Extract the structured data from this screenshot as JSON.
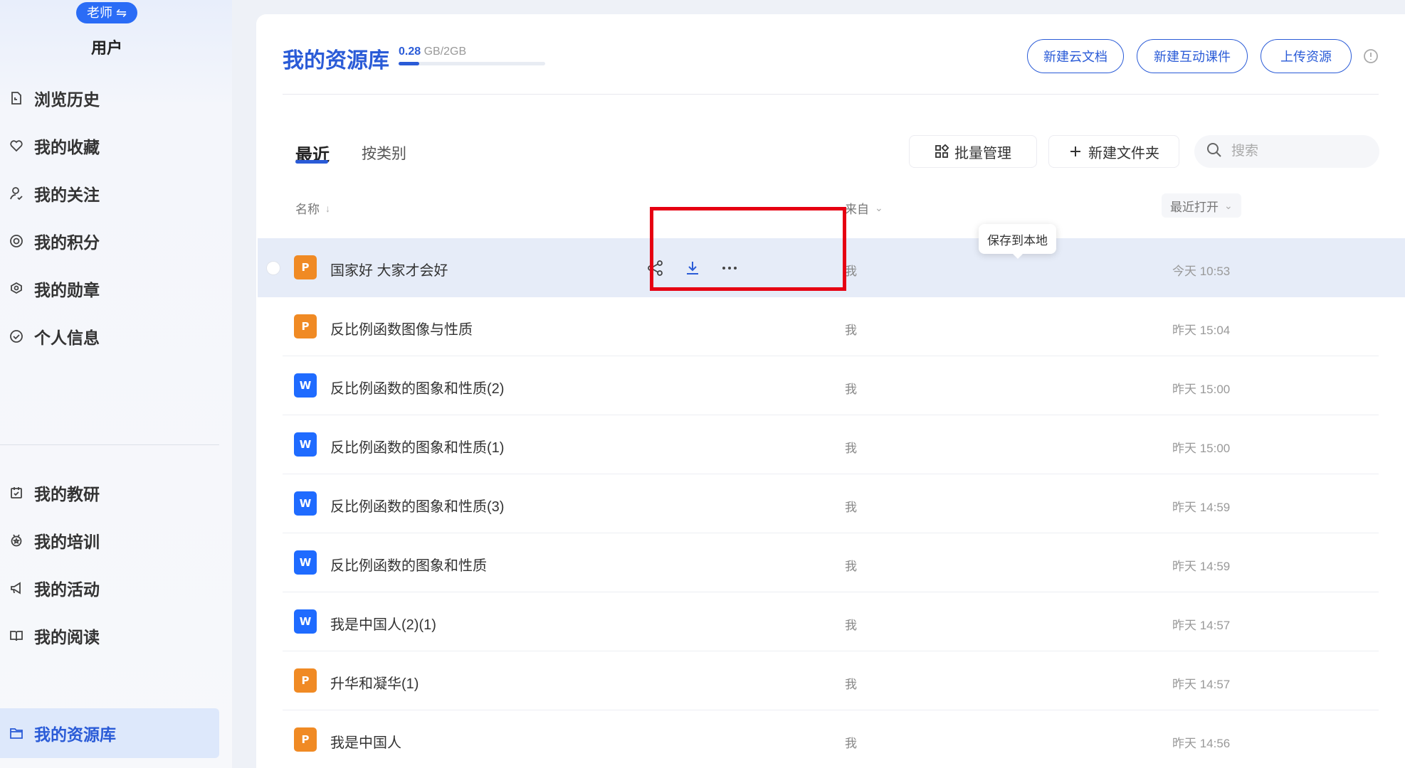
{
  "sidebar": {
    "role_badge": "老师 ⇋",
    "user_name": "用户",
    "items": [
      {
        "label": "浏览历史",
        "icon": "history-icon"
      },
      {
        "label": "我的收藏",
        "icon": "heart-icon"
      },
      {
        "label": "我的关注",
        "icon": "follow-icon"
      },
      {
        "label": "我的积分",
        "icon": "points-icon"
      },
      {
        "label": "我的勋章",
        "icon": "medal-icon"
      },
      {
        "label": "个人信息",
        "icon": "check-circle-icon"
      },
      {
        "label": "我的教研",
        "icon": "research-icon"
      },
      {
        "label": "我的培训",
        "icon": "training-icon"
      },
      {
        "label": "我的活动",
        "icon": "megaphone-icon"
      },
      {
        "label": "我的阅读",
        "icon": "book-icon"
      },
      {
        "label": "我的资源库",
        "icon": "folder-icon",
        "active": true
      }
    ]
  },
  "header": {
    "title": "我的资源库",
    "storage_used": "0.28",
    "storage_total": "GB/2GB",
    "storage_fraction": 0.14,
    "buttons": {
      "new_cloud_doc": "新建云文档",
      "new_interactive": "新建互动课件",
      "upload": "上传资源"
    }
  },
  "tabs": {
    "recent": "最近",
    "by_category": "按类别"
  },
  "toolbar": {
    "batch_manage": "批量管理",
    "new_folder": "新建文件夹",
    "search_placeholder": "搜索"
  },
  "columns": {
    "name": "名称",
    "source": "来自",
    "last_opened": "最近打开"
  },
  "tooltip": "保存到本地",
  "files": [
    {
      "name": "国家好 大家才会好",
      "type": "ppt",
      "source": "我",
      "time": "今天 10:53"
    },
    {
      "name": "反比例函数图像与性质",
      "type": "ppt",
      "source": "我",
      "time": "昨天 15:04"
    },
    {
      "name": "反比例函数的图象和性质(2)",
      "type": "word",
      "source": "我",
      "time": "昨天 15:00"
    },
    {
      "name": "反比例函数的图象和性质(1)",
      "type": "word",
      "source": "我",
      "time": "昨天 15:00"
    },
    {
      "name": "反比例函数的图象和性质(3)",
      "type": "word",
      "source": "我",
      "time": "昨天 14:59"
    },
    {
      "name": "反比例函数的图象和性质",
      "type": "word",
      "source": "我",
      "time": "昨天 14:59"
    },
    {
      "name": "我是中国人(2)(1)",
      "type": "word",
      "source": "我",
      "time": "昨天 14:57"
    },
    {
      "name": "升华和凝华(1)",
      "type": "ppt",
      "source": "我",
      "time": "昨天 14:57"
    },
    {
      "name": "我是中国人",
      "type": "ppt",
      "source": "我",
      "time": "昨天 14:56"
    }
  ],
  "colors": {
    "accent": "#2a5bd7",
    "ppt": "#f08a24",
    "word": "#1f6bff",
    "highlight": "#e60012"
  }
}
